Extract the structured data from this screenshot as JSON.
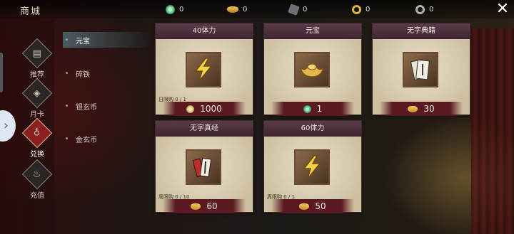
{
  "header": {
    "title": "商城",
    "currencies": [
      {
        "icon": "jade-icon",
        "value": "0",
        "color": "#3fbf7f"
      },
      {
        "icon": "gold-ingot-icon",
        "value": "0",
        "color": "#e0b050"
      },
      {
        "icon": "iron-icon",
        "value": "0",
        "color": "#9a9aa0"
      },
      {
        "icon": "gold-coin-icon",
        "value": "0",
        "color": "#e0b040"
      },
      {
        "icon": "silver-coin-icon",
        "value": "0",
        "color": "#b0b0b0"
      }
    ],
    "close": "✕"
  },
  "main_nav": [
    {
      "label": "推荐",
      "icon": "recommend-icon",
      "active": false
    },
    {
      "label": "月卡",
      "icon": "monthly-card-icon",
      "active": false
    },
    {
      "label": "兑换",
      "icon": "exchange-icon",
      "active": true
    },
    {
      "label": "充值",
      "icon": "recharge-icon",
      "active": false
    }
  ],
  "sub_nav": [
    {
      "label": "元宝",
      "active": true
    },
    {
      "label": "碎铁",
      "active": false
    },
    {
      "label": "银玄币",
      "active": false
    },
    {
      "label": "金玄币",
      "active": false
    }
  ],
  "cards": [
    {
      "title": "40体力",
      "item_icon": "lightning-icon",
      "limit": "日限购 0 / 1",
      "price": "1000",
      "price_icon": "copper-coin-icon"
    },
    {
      "title": "元宝",
      "item_icon": "gold-ingot-icon",
      "limit": "",
      "price": "1",
      "price_icon": "jade-icon"
    },
    {
      "title": "无字典籍",
      "item_icon": "book-icon",
      "limit": "",
      "price": "30",
      "price_icon": "gold-ingot-icon"
    },
    {
      "title": "无字真经",
      "item_icon": "scroll-icon",
      "limit": "周限购 0 / 10",
      "price": "60",
      "price_icon": "gold-ingot-icon"
    },
    {
      "title": "60体力",
      "item_icon": "lightning-icon",
      "limit": "周限购 0 / 1",
      "price": "50",
      "price_icon": "gold-ingot-icon"
    }
  ]
}
